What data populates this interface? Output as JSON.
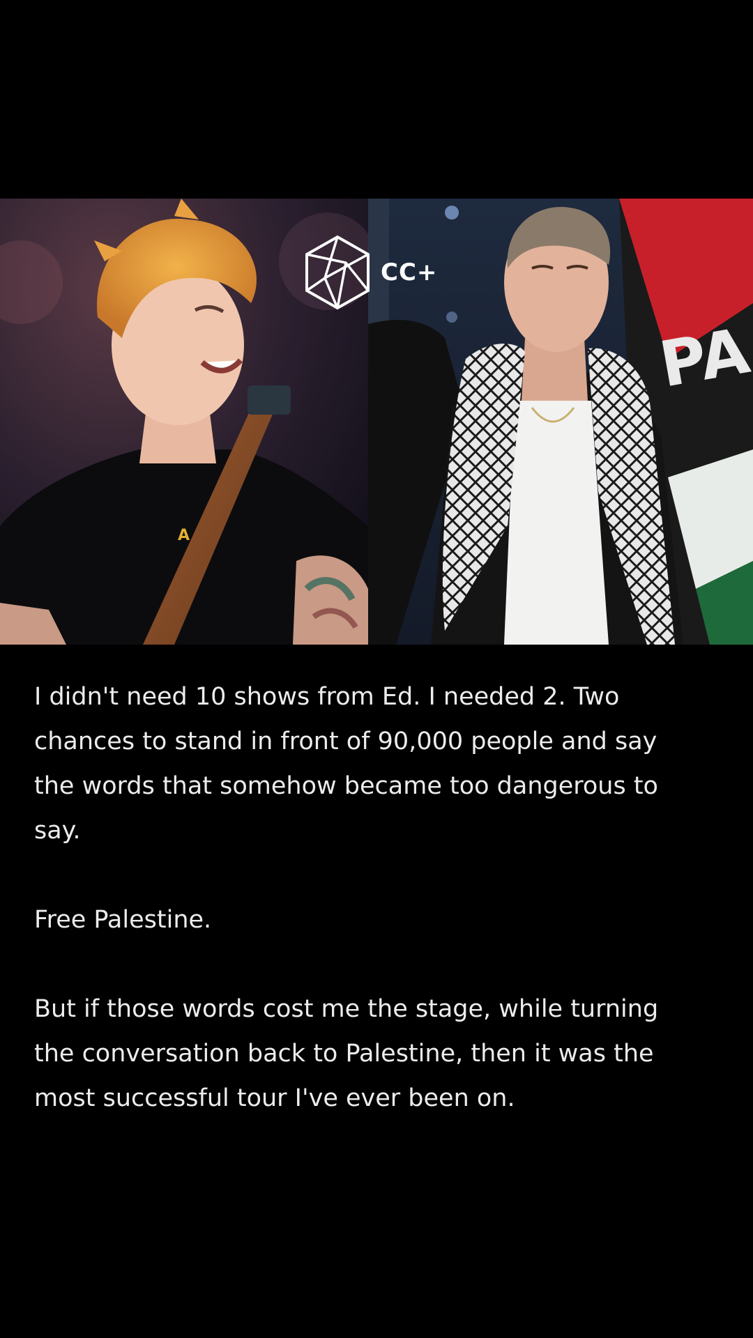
{
  "logo": {
    "text": "CC+",
    "icon": "hexagon-cube-icon"
  },
  "photos": {
    "left": {
      "shirt_text": "A"
    },
    "right": {
      "flag_text": "PA"
    }
  },
  "post": {
    "paragraphs": [
      "I didn't need 10 shows from Ed. I needed 2. Two chances to stand in front of 90,000 people and say the words that somehow became too dangerous to say.",
      "Free Palestine.",
      "But if those words cost me the stage, while turning the conversation back to Palestine, then it was the most successful tour I've ever been on."
    ]
  },
  "colors": {
    "background": "#000000",
    "text": "#ececec"
  }
}
